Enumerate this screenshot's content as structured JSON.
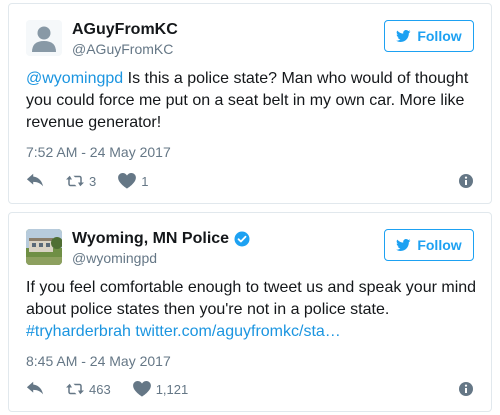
{
  "tweets": [
    {
      "display_name": "AGuyFromKC",
      "handle": "@AGuyFromKC",
      "follow_label": "Follow",
      "verified": false,
      "text_lines": [
        {
          "mention": "@wyomingpd",
          "rest": " Is this a police state? Man who would of thought"
        },
        {
          "text": "you could force me put on a seat belt in my own car. More like"
        },
        {
          "text": "revenue generator!"
        }
      ],
      "timestamp": "7:52 AM - 24 May 2017",
      "retweets": "3",
      "likes": "1",
      "icons": {
        "avatar": "default-avatar-icon",
        "reply": "reply-icon",
        "retweet": "retweet-icon",
        "like": "heart-icon",
        "info": "info-icon"
      }
    },
    {
      "display_name": "Wyoming, MN Police",
      "handle": "@wyomingpd",
      "follow_label": "Follow",
      "verified": true,
      "text_lines": [
        {
          "text": "If you feel comfortable enough to tweet us and speak your mind"
        },
        {
          "text": "about police states then you're not in a police state."
        },
        {
          "link": "#tryharderbrah twitter.com/aguyfromkc/sta…"
        }
      ],
      "timestamp": "8:45 AM - 24 May 2017",
      "retweets": "463",
      "likes": "1,121",
      "icons": {
        "avatar": "police-building-avatar",
        "verified": "verified-badge-icon",
        "reply": "reply-icon",
        "retweet": "retweet-icon",
        "like": "heart-icon",
        "info": "info-icon"
      }
    }
  ],
  "colors": {
    "brand_blue": "#1da1f2",
    "link_blue": "#1b95e0",
    "secondary_text": "#657786",
    "border": "#e1e8ed"
  }
}
